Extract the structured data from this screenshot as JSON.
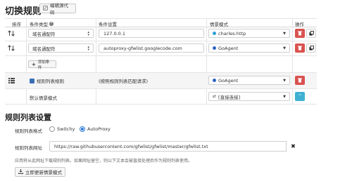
{
  "header": {
    "title": "切换规则",
    "edit_source_label": "编辑源代码"
  },
  "table": {
    "columns": [
      "排序",
      "条件类型",
      "条件设置",
      "情景模式",
      "操作"
    ],
    "rows": [
      {
        "type": "域名通配符",
        "value": "127.0.0.1",
        "profile": "charles-http",
        "profile_color": "#2aa0d6"
      },
      {
        "type": "域名通配符",
        "value": "autoproxy-gfwlist.googlecode.com",
        "profile": "GoAgent",
        "profile_color": "#2f64c6"
      }
    ],
    "add_condition_label": "添加条件",
    "rulelist_row": {
      "type": "规则列表规则",
      "value": "(按照规则列表匹配请求)",
      "profile": "GoAgent"
    },
    "default_row": {
      "type": "默认情景模式",
      "profile": "[直接连接]"
    }
  },
  "rulelist": {
    "title": "规则列表设置",
    "format_label": "规则列表格式",
    "options": [
      "Switchy",
      "AutoProxy"
    ],
    "selected_option": "AutoProxy",
    "url_label": "规则列表网址",
    "url_value": "https://raw.githubusercontent.com/gfwlist/gfwlist/master/gfwlist.txt",
    "help_text": "应用将从此网址下载规则列表。如果网址留空，则以下文本会被直接处理后作为规则列表使用。",
    "update_label": "立即更新情景模式"
  },
  "colors": {
    "danger": "#d9534f",
    "info": "#3fb0d2",
    "goagent": "#2f64c6"
  }
}
